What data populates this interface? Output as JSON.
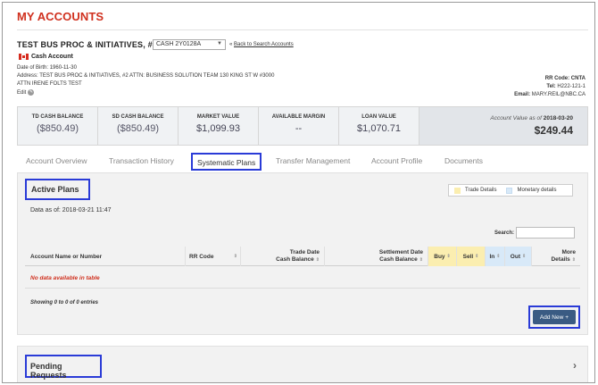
{
  "page_title": "MY ACCOUNTS",
  "account": {
    "name": "TEST BUS PROC & INITIATIVES, #2",
    "selector_value": "CASH 2Y0128A",
    "back_link": "Back to Search Accounts",
    "type": "Cash Account",
    "dob_label": "Date of Birth:",
    "dob": "1960-11-30",
    "address_label": "Address:",
    "address": "TEST BUS PROC & INITIATIVES, #2 ATTN: BUSINESS SOLUTION TEAM 130 KING ST W #3000",
    "attn": "ATTN IRENE FOLTS TEST",
    "edit_label": "Edit",
    "rr_code_label": "RR Code:",
    "rr_code": "CNTA",
    "tel_label": "Tel:",
    "tel": "H222-121-1",
    "email_label": "Email:",
    "email": "MARY.REIL@NBC.CA"
  },
  "summary": {
    "cells": [
      {
        "label": "TD CASH BALANCE",
        "value": "($850.49)"
      },
      {
        "label": "SD CASH BALANCE",
        "value": "($850.49)"
      },
      {
        "label": "MARKET VALUE",
        "value": "$1,099.93"
      },
      {
        "label": "AVAILABLE MARGIN",
        "value": "--"
      },
      {
        "label": "LOAN VALUE",
        "value": "$1,070.71"
      }
    ],
    "total_label": "Account Value as of",
    "total_date": "2018-03-20",
    "total_value": "$249.44"
  },
  "tabs": [
    {
      "label": "Account Overview"
    },
    {
      "label": "Transaction History"
    },
    {
      "label": "Systematic Plans"
    },
    {
      "label": "Transfer Management"
    },
    {
      "label": "Account Profile"
    },
    {
      "label": "Documents"
    }
  ],
  "plans": {
    "title": "Active Plans",
    "legend_trade": "Trade Details",
    "legend_monetary": "Monetary details",
    "data_as_of": "Data as of: 2018-03-21 11:47",
    "search_label": "Search:",
    "columns": {
      "account": "Account Name or Number",
      "rr_code": "RR Code",
      "trade_date_1": "Trade Date",
      "trade_date_2": "Cash Balance",
      "settlement_1": "Settlement Date",
      "settlement_2": "Cash Balance",
      "buy": "Buy",
      "sell": "Sell",
      "in": "In",
      "out": "Out",
      "more_1": "More",
      "more_2": "Details"
    },
    "empty_text": "No data available in table",
    "showing": "Showing 0 to 0 of 0 entries",
    "add_new": "Add New",
    "colors": {
      "highlight_border": "#2a3bd7",
      "trade": "#fbeeb0",
      "monetary": "#d8e9f8",
      "button": "#3a5b83",
      "brand": "#d0311f"
    }
  },
  "pending": {
    "title": "Pending Requests"
  }
}
